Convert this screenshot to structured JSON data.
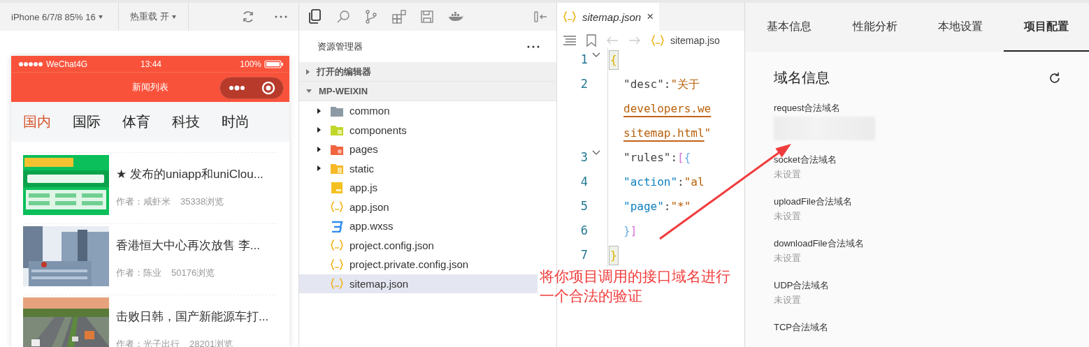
{
  "simulator": {
    "device": "iPhone 6/7/8 85% 16",
    "hot_reload": "热重载 开",
    "phone": {
      "carrier": "WeChat4G",
      "time": "13:44",
      "battery": "100%",
      "title": "新闻列表",
      "tabs": [
        {
          "label": "国内",
          "selected": true
        },
        {
          "label": "国际",
          "selected": false
        },
        {
          "label": "体育",
          "selected": false
        },
        {
          "label": "科技",
          "selected": false
        },
        {
          "label": "时尚",
          "selected": false
        }
      ],
      "articles": [
        {
          "title": "★ 发布的uniapp和uniClou...",
          "author": "作者：咸虾米",
          "views": "35338浏览"
        },
        {
          "title": "香港恒大中心再次放售 李...",
          "author": "作者：陈业",
          "views": "50176浏览"
        },
        {
          "title": "击败日韩，国产新能源车打...",
          "author": "作者：光子出行",
          "views": "28201浏览"
        }
      ]
    }
  },
  "explorer": {
    "title": "资源管理器",
    "sections": [
      {
        "label": "打开的编辑器",
        "expanded": false
      },
      {
        "label": "MP-WEIXIN",
        "expanded": true,
        "children": [
          {
            "label": "common",
            "kind": "plainfolder",
            "expanded": false,
            "selected": false
          },
          {
            "label": "components",
            "kind": "componentfolder",
            "expanded": false,
            "selected": false
          },
          {
            "label": "pages",
            "kind": "pagefolder",
            "expanded": false,
            "selected": false
          },
          {
            "label": "static",
            "kind": "assetfolder",
            "expanded": false,
            "selected": false
          },
          {
            "label": "app.js",
            "kind": "script",
            "selected": false
          },
          {
            "label": "app.json",
            "kind": "json",
            "selected": false
          },
          {
            "label": "app.wxss",
            "kind": "style",
            "selected": false
          },
          {
            "label": "project.config.json",
            "kind": "json",
            "selected": false
          },
          {
            "label": "project.private.config.json",
            "kind": "json",
            "selected": false
          },
          {
            "label": "sitemap.json",
            "kind": "json",
            "selected": true
          }
        ]
      }
    ]
  },
  "editor": {
    "tab": {
      "label": "sitemap.json",
      "close": "×"
    },
    "breadcrumb": "sitemap.jso",
    "lines": [
      {
        "number": "1",
        "foldable": true,
        "segments": [
          {
            "kind": "brace",
            "text": "{"
          }
        ]
      },
      {
        "number": "2",
        "foldable": false,
        "segments": [
          {
            "kind": "key",
            "text": "\"desc\": "
          },
          {
            "kind": "str",
            "text": "\"关于"
          }
        ]
      },
      {
        "segments": [
          {
            "kind": "link",
            "text": "developers.we"
          }
        ]
      },
      {
        "segments": [
          {
            "kind": "link",
            "text": "sitemap.html"
          },
          {
            "kind": "str",
            "text": "\""
          }
        ]
      },
      {
        "number": "3",
        "foldable": true,
        "segments": [
          {
            "kind": "key",
            "text": "\"rules\": "
          },
          {
            "kind": "bracket",
            "text": "["
          },
          {
            "kind": "brace2",
            "text": "{"
          }
        ]
      },
      {
        "number": "4",
        "foldable": false,
        "segments": [
          {
            "kind": "key2",
            "text": "\"action\""
          },
          {
            "kind": "punct",
            "text": ": "
          },
          {
            "kind": "str",
            "text": "\"al"
          }
        ]
      },
      {
        "number": "5",
        "foldable": false,
        "segments": [
          {
            "kind": "key2",
            "text": "\"page\""
          },
          {
            "kind": "punct",
            "text": ": "
          },
          {
            "kind": "str",
            "text": "\"*\""
          }
        ]
      },
      {
        "number": "6",
        "foldable": false,
        "segments": [
          {
            "kind": "brace2",
            "text": "}"
          },
          {
            "kind": "bracket",
            "text": "]"
          }
        ]
      },
      {
        "number": "7",
        "foldable": false,
        "segments": [
          {
            "kind": "brace",
            "text": "}"
          }
        ]
      }
    ]
  },
  "details": {
    "tabs": [
      {
        "label": "基本信息",
        "selected": false
      },
      {
        "label": "性能分析",
        "selected": false
      },
      {
        "label": "本地设置",
        "selected": false
      },
      {
        "label": "项目配置",
        "selected": true
      }
    ],
    "section_title": "域名信息",
    "domains": [
      {
        "label": "request合法域名",
        "value_hidden": true
      },
      {
        "label": "socket合法域名",
        "value": "未设置"
      },
      {
        "label": "uploadFile合法域名",
        "value": "未设置"
      },
      {
        "label": "downloadFile合法域名",
        "value": "未设置"
      },
      {
        "label": "UDP合法域名",
        "value": "未设置"
      },
      {
        "label": "TCP合法域名"
      }
    ]
  },
  "annotation": {
    "lines": [
      "将你项目调用的接口域名进行",
      "一个合法的验证"
    ]
  }
}
